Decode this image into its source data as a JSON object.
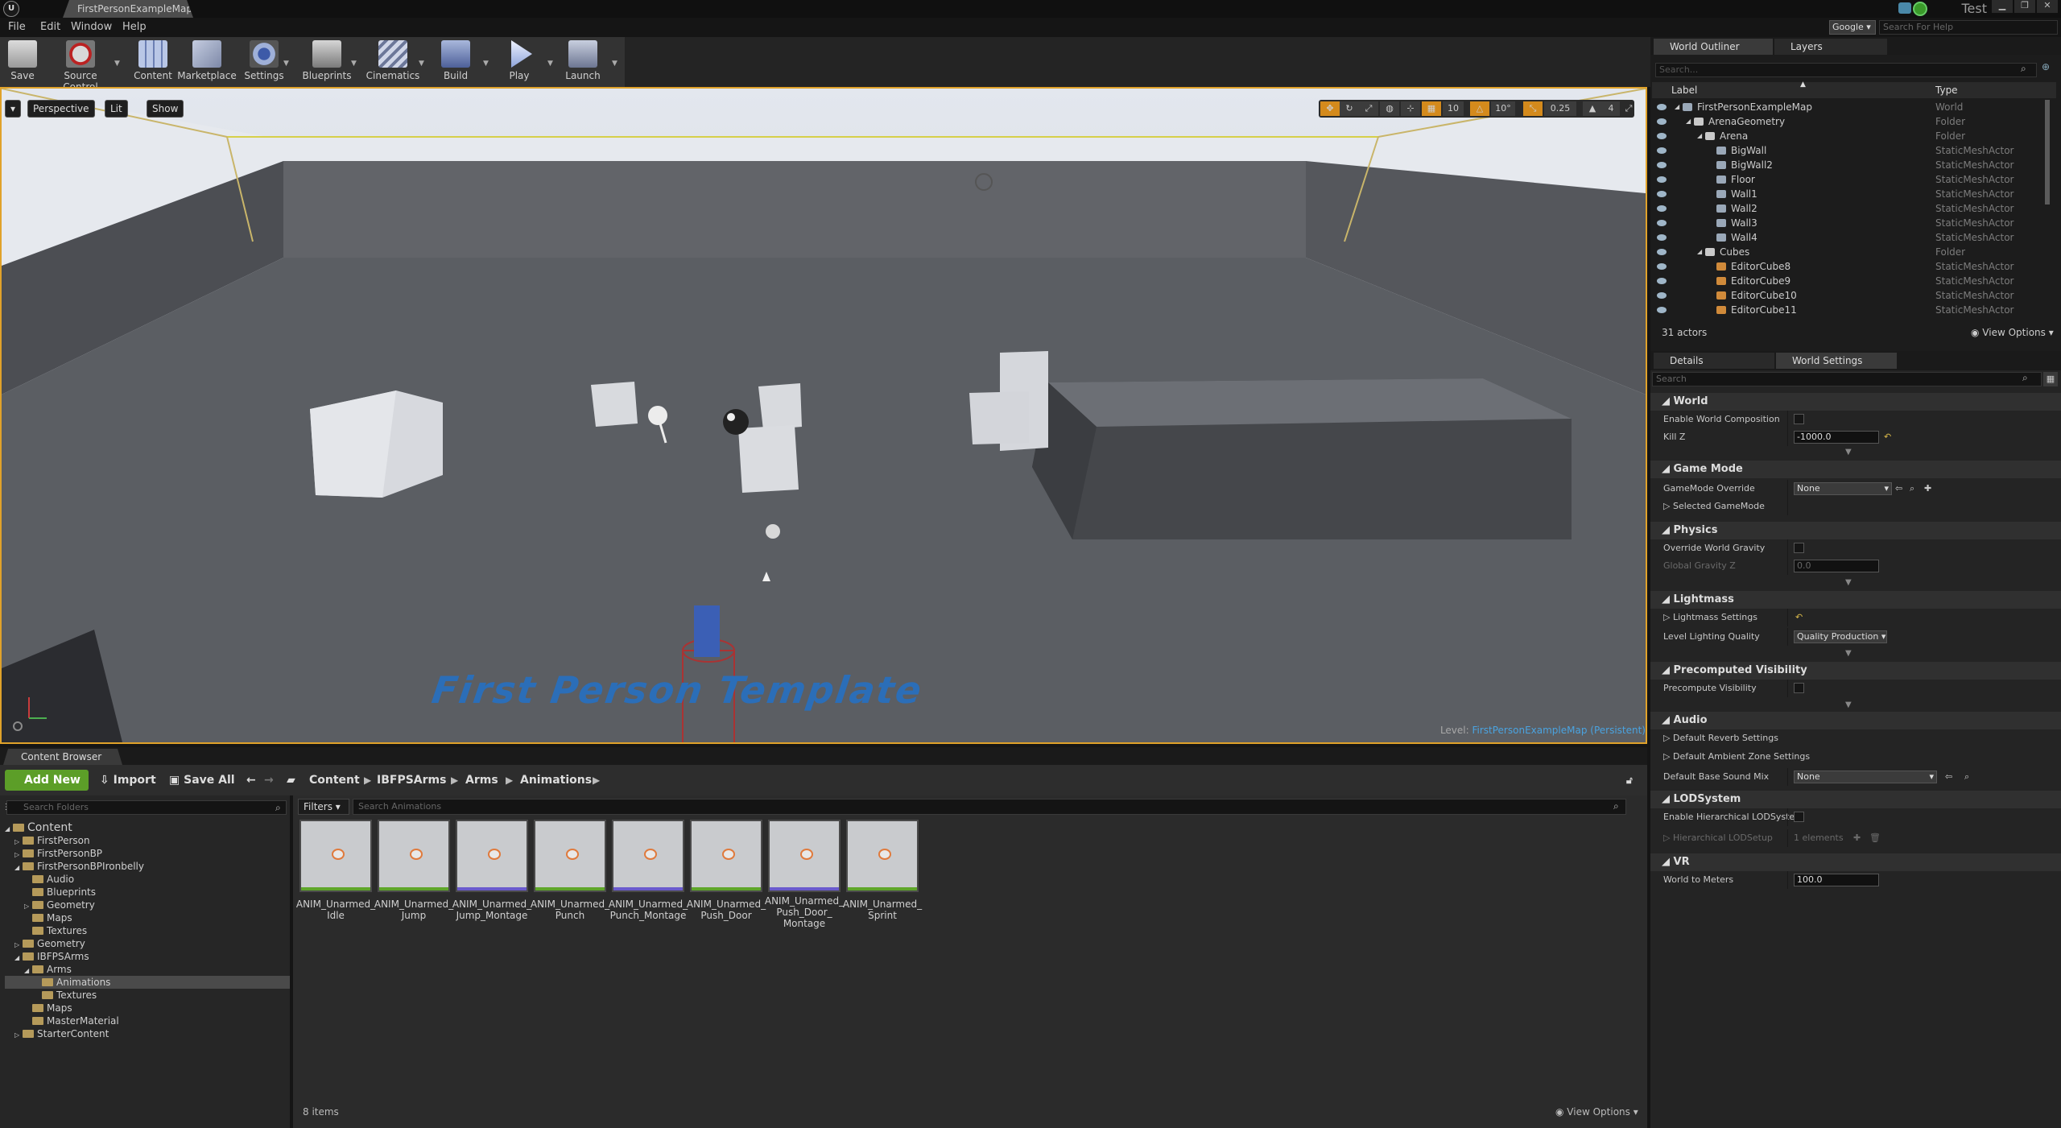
{
  "window": {
    "tab_title": "FirstPersonExampleMap",
    "logo_text": "U",
    "user": "Test",
    "search_provider": "Google",
    "help_search_placeholder": "Search For Help"
  },
  "menu": [
    "File",
    "Edit",
    "Window",
    "Help"
  ],
  "toolbar": {
    "buttons": [
      "Save",
      "Source Control",
      "Content",
      "Marketplace",
      "Settings",
      "Blueprints",
      "Cinematics",
      "Build",
      "Play",
      "Launch"
    ]
  },
  "viewport": {
    "perspective": "Perspective",
    "lit": "Lit",
    "show": "Show",
    "grid_snap": "10",
    "rotation_snap": "10°",
    "scale_snap": "0.25",
    "camera_speed": "4",
    "template_text": "First Person Template",
    "level_prefix": "Level:",
    "level_name": "FirstPersonExampleMap (Persistent)"
  },
  "content_browser": {
    "tab_label": "Content Browser",
    "add_new": "Add New",
    "import": "Import",
    "save_all": "Save All",
    "breadcrumbs": [
      "Content",
      "IBFPSArms",
      "Arms",
      "Animations"
    ],
    "folder_search_placeholder": "Search Folders",
    "filters_label": "Filters",
    "asset_search_placeholder": "Search Animations",
    "tree": [
      {
        "label": "Content",
        "depth": 0,
        "arrow": "◢"
      },
      {
        "label": "FirstPerson",
        "depth": 1,
        "arrow": "▷"
      },
      {
        "label": "FirstPersonBP",
        "depth": 1,
        "arrow": "▷"
      },
      {
        "label": "FirstPersonBPIronbelly",
        "depth": 1,
        "arrow": "◢"
      },
      {
        "label": "Audio",
        "depth": 2,
        "arrow": ""
      },
      {
        "label": "Blueprints",
        "depth": 2,
        "arrow": ""
      },
      {
        "label": "Geometry",
        "depth": 2,
        "arrow": "▷"
      },
      {
        "label": "Maps",
        "depth": 2,
        "arrow": ""
      },
      {
        "label": "Textures",
        "depth": 2,
        "arrow": ""
      },
      {
        "label": "Geometry",
        "depth": 1,
        "arrow": "▷"
      },
      {
        "label": "IBFPSArms",
        "depth": 1,
        "arrow": "◢"
      },
      {
        "label": "Arms",
        "depth": 2,
        "arrow": "◢"
      },
      {
        "label": "Animations",
        "depth": 3,
        "arrow": ""
      },
      {
        "label": "Textures",
        "depth": 3,
        "arrow": ""
      },
      {
        "label": "Maps",
        "depth": 2,
        "arrow": ""
      },
      {
        "label": "MasterMaterial",
        "depth": 2,
        "arrow": ""
      },
      {
        "label": "StarterContent",
        "depth": 1,
        "arrow": "▷"
      }
    ],
    "assets": [
      {
        "name": "ANIM_Unarmed_Idle",
        "line1": "ANIM_Unarmed_",
        "line2": "Idle",
        "line3": ""
      },
      {
        "name": "ANIM_Unarmed_Jump",
        "line1": "ANIM_Unarmed_",
        "line2": "Jump",
        "line3": ""
      },
      {
        "name": "ANIM_Unarmed_Jump_Montage",
        "line1": "ANIM_Unarmed_",
        "line2": "Jump_Montage",
        "line3": ""
      },
      {
        "name": "ANIM_Unarmed_Punch",
        "line1": "ANIM_Unarmed_",
        "line2": "Punch",
        "line3": ""
      },
      {
        "name": "ANIM_Unarmed_Punch_Montage",
        "line1": "ANIM_Unarmed_",
        "line2": "Punch_Montage",
        "line3": ""
      },
      {
        "name": "ANIM_Unarmed_Push_Door",
        "line1": "ANIM_Unarmed_",
        "line2": "Push_Door",
        "line3": ""
      },
      {
        "name": "ANIM_Unarmed_Push_Door_Montage",
        "line1": "ANIM_Unarmed_",
        "line2": "Push_Door_",
        "line3": "Montage"
      },
      {
        "name": "ANIM_Unarmed_Sprint",
        "line1": "ANIM_Unarmed_",
        "line2": "Sprint",
        "line3": ""
      }
    ],
    "item_count": "8 items",
    "view_options": "View Options"
  },
  "outliner": {
    "tab_label": "World Outliner",
    "layers_tab": "Layers",
    "search_placeholder": "Search...",
    "col_label": "Label",
    "col_type": "Type",
    "rows": [
      {
        "label": "FirstPersonExampleMap",
        "type": "World",
        "depth": 0
      },
      {
        "label": "ArenaGeometry",
        "type": "Folder",
        "depth": 1
      },
      {
        "label": "Arena",
        "type": "Folder",
        "depth": 2
      },
      {
        "label": "BigWall",
        "type": "StaticMeshActor",
        "depth": 3
      },
      {
        "label": "BigWall2",
        "type": "StaticMeshActor",
        "depth": 3
      },
      {
        "label": "Floor",
        "type": "StaticMeshActor",
        "depth": 3
      },
      {
        "label": "Wall1",
        "type": "StaticMeshActor",
        "depth": 3
      },
      {
        "label": "Wall2",
        "type": "StaticMeshActor",
        "depth": 3
      },
      {
        "label": "Wall3",
        "type": "StaticMeshActor",
        "depth": 3
      },
      {
        "label": "Wall4",
        "type": "StaticMeshActor",
        "depth": 3
      },
      {
        "label": "Cubes",
        "type": "Folder",
        "depth": 2
      },
      {
        "label": "EditorCube8",
        "type": "StaticMeshActor",
        "depth": 3
      },
      {
        "label": "EditorCube9",
        "type": "StaticMeshActor",
        "depth": 3
      },
      {
        "label": "EditorCube10",
        "type": "StaticMeshActor",
        "depth": 3
      },
      {
        "label": "EditorCube11",
        "type": "StaticMeshActor",
        "depth": 3
      }
    ],
    "actor_count": "31 actors",
    "view_options": "View Options"
  },
  "details": {
    "details_tab": "Details",
    "world_settings_tab": "World Settings",
    "search_placeholder": "Search",
    "world": {
      "title": "World",
      "enable_world_composition": "Enable World Composition",
      "kill_z_label": "Kill Z",
      "kill_z_value": "-1000.0"
    },
    "game_mode": {
      "title": "Game Mode",
      "override_label": "GameMode Override",
      "override_value": "None",
      "selected_label": "Selected GameMode"
    },
    "physics": {
      "title": "Physics",
      "override_gravity": "Override World Gravity",
      "gravity_label": "Global Gravity Z",
      "gravity_value": "0.0"
    },
    "lightmass": {
      "title": "Lightmass",
      "settings_label": "Lightmass Settings",
      "quality_label": "Level Lighting Quality",
      "quality_value": "Quality Production"
    },
    "precomputed": {
      "title": "Precomputed Visibility",
      "label": "Precompute Visibility"
    },
    "audio": {
      "title": "Audio",
      "reverb": "Default Reverb Settings",
      "ambient": "Default Ambient Zone Settings",
      "sound_mix_label": "Default Base Sound Mix",
      "sound_mix_value": "None"
    },
    "lod": {
      "title": "LODSystem",
      "enable": "Enable Hierarchical LODSystem",
      "setup_label": "Hierarchical LODSetup",
      "setup_value": "1 elements"
    },
    "vr": {
      "title": "VR",
      "world_to_meters": "World to Meters",
      "world_to_meters_value": "100.0"
    }
  },
  "colors": {
    "accent_orange": "#e0a22a",
    "add_new_green": "#5c9e28",
    "level_blue": "#4aa3e0",
    "template_text_blue": "#2b6eb8"
  }
}
